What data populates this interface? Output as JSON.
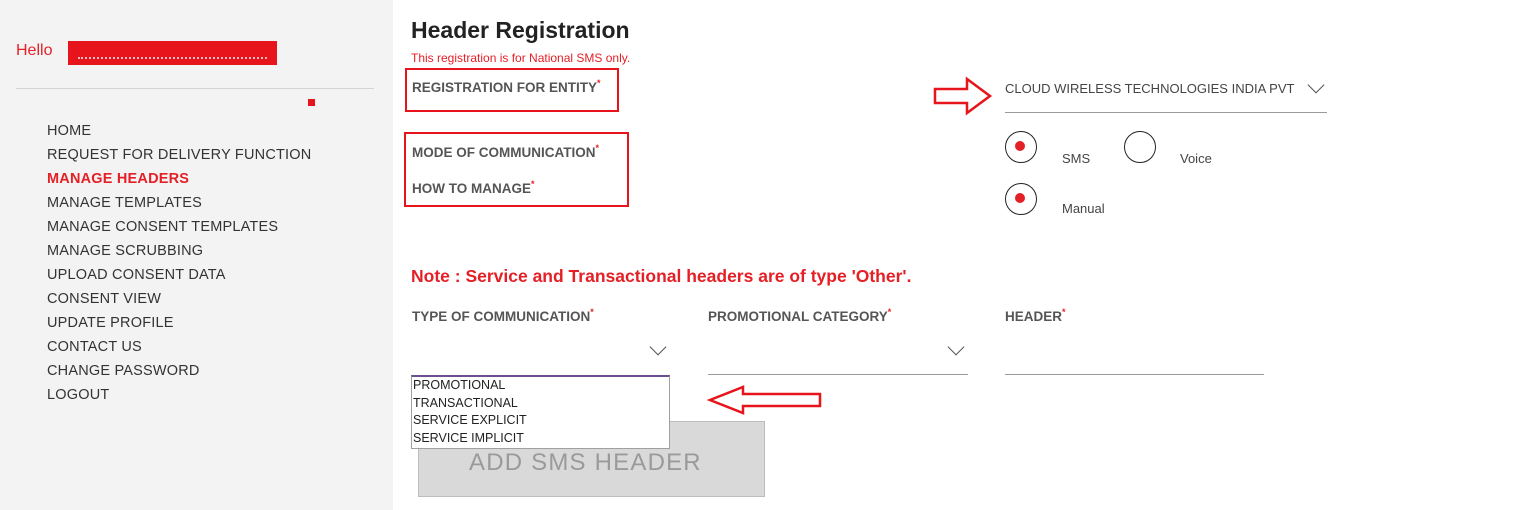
{
  "sidebar": {
    "greeting": "Hello",
    "nav": [
      {
        "label": "HOME"
      },
      {
        "label": "REQUEST FOR DELIVERY FUNCTION"
      },
      {
        "label": "MANAGE HEADERS",
        "active": true
      },
      {
        "label": "MANAGE TEMPLATES"
      },
      {
        "label": "MANAGE CONSENT TEMPLATES"
      },
      {
        "label": "MANAGE SCRUBBING"
      },
      {
        "label": "UPLOAD CONSENT DATA"
      },
      {
        "label": "CONSENT VIEW"
      },
      {
        "label": "UPDATE PROFILE"
      },
      {
        "label": "CONTACT US"
      },
      {
        "label": "CHANGE PASSWORD"
      },
      {
        "label": "LOGOUT"
      }
    ]
  },
  "main": {
    "title": "Header Registration",
    "subtitle": "This registration is for National SMS only.",
    "fields": {
      "entity": {
        "label": "REGISTRATION FOR ENTITY",
        "value": "CLOUD WIRELESS TECHNOLOGIES INDIA PVT LTD"
      },
      "mode": {
        "label": "MODE OF COMMUNICATION",
        "options": [
          "SMS",
          "Voice"
        ],
        "selected": "SMS"
      },
      "manage": {
        "label": "HOW TO MANAGE",
        "options": [
          "Manual"
        ],
        "selected": "Manual"
      }
    },
    "note": "Note : Service and Transactional headers are of type 'Other'.",
    "type_of_communication": {
      "label": "TYPE OF COMMUNICATION",
      "options": [
        "PROMOTIONAL",
        "TRANSACTIONAL",
        "SERVICE EXPLICIT",
        "SERVICE IMPLICIT"
      ]
    },
    "promotional_category": {
      "label": "PROMOTIONAL CATEGORY"
    },
    "header": {
      "label": "HEADER"
    },
    "add_button": "ADD SMS HEADER",
    "required_mark": "*"
  },
  "colors": {
    "accent": "#e41f26",
    "sidebar_bg": "#f3f3f3",
    "annotation": "#e8141b"
  },
  "icons": [
    "chevron-down-icon",
    "arrow-right-icon",
    "arrow-left-icon"
  ]
}
